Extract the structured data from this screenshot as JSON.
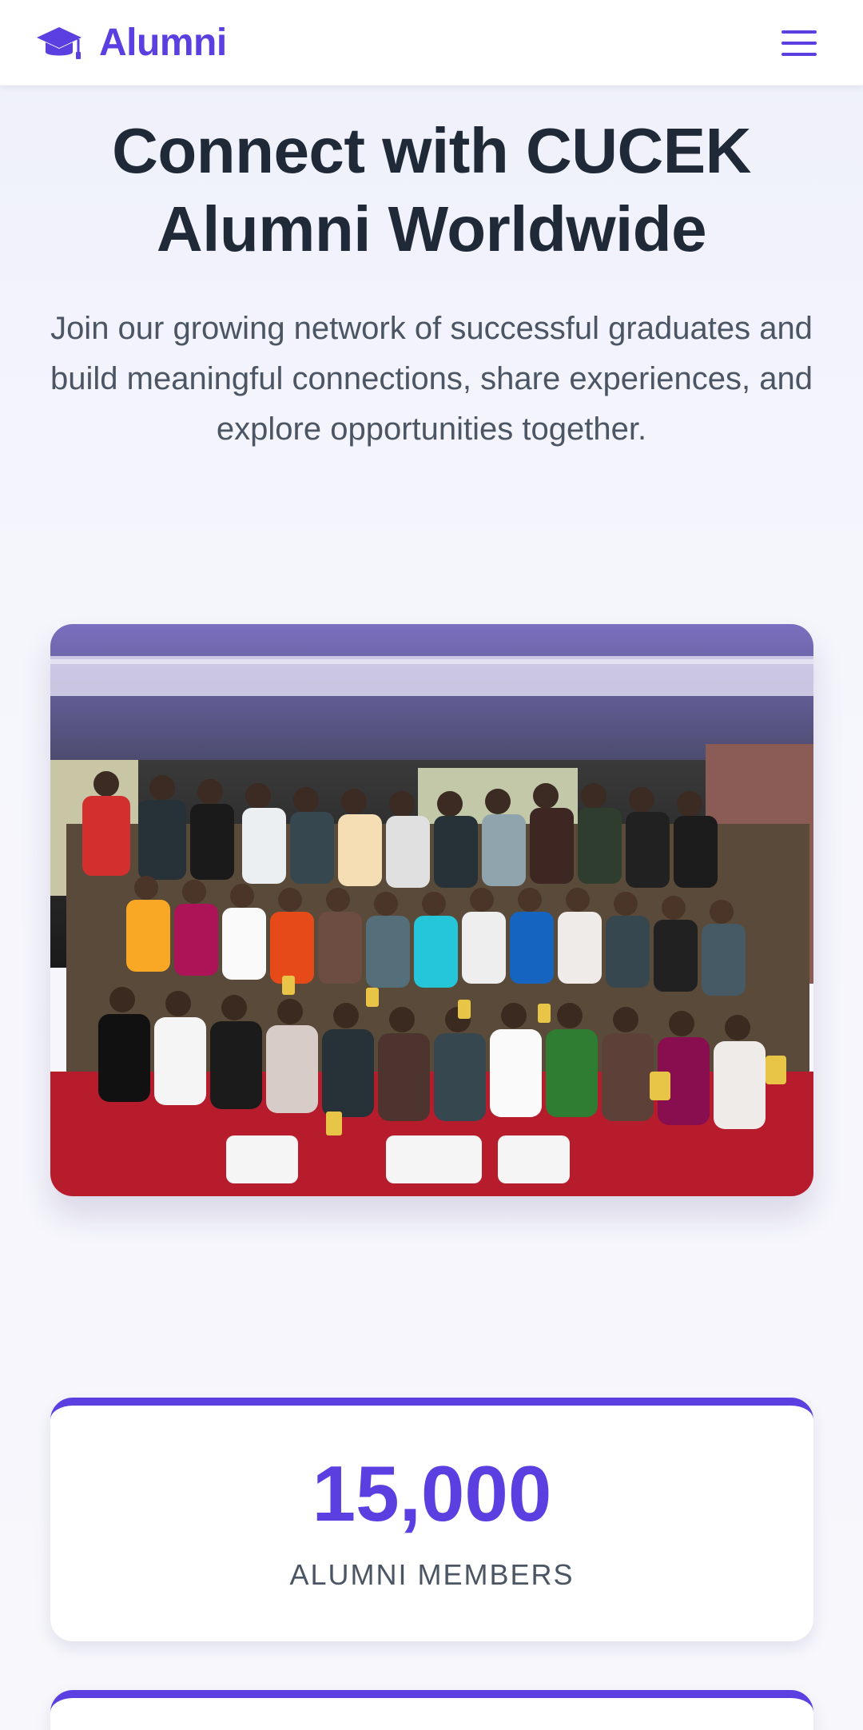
{
  "navbar": {
    "brand_icon": "graduation-cap-icon",
    "brand_text": "Alumni",
    "menu_icon": "hamburger-menu-icon",
    "accent_color": "#5b3fe0"
  },
  "hero": {
    "title": "Connect with CUCEK Alumni Worldwide",
    "subtitle": "Join our growing network of successful graduates and build meaningful connections, share experiences, and explore opportunities together."
  },
  "photo": {
    "description_icon": "group-photo"
  },
  "stats": [
    {
      "value": "15,000",
      "label": "ALUMNI MEMBERS"
    }
  ]
}
